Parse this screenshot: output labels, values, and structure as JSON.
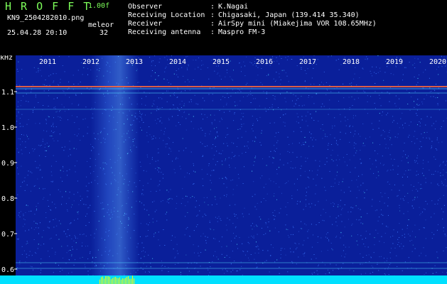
{
  "header": {
    "app_title": "H R O F F T",
    "version": "1.00f",
    "filename": "KN9_2504282010.png",
    "datetime": "25.04.28 20:10",
    "mode_label": "meleor",
    "mode_value": "32",
    "meta": [
      {
        "key": "Observer",
        "value": "K.Nagai"
      },
      {
        "key": "Receiving Location",
        "value": "Chigasaki, Japan (139.414 35.340)"
      },
      {
        "key": "Receiver",
        "value": "AirSpy mini (Miakejima VOR 108.65MHz)"
      },
      {
        "key": "Receiving antenna",
        "value": "Maspro FM-3"
      }
    ],
    "separator": ":"
  },
  "spectrogram": {
    "y_unit": "kHz",
    "y_ticks": [
      "1.1",
      "1.0",
      "0.9",
      "0.8",
      "0.7",
      "0.6"
    ],
    "x_ticks": [
      "2011",
      "2012",
      "2013",
      "2014",
      "2015",
      "2016",
      "2017",
      "2018",
      "2019",
      "2020"
    ],
    "colors": {
      "background": "#0a1f9a",
      "noise_light": "#3c78ff",
      "noise_cyan": "#50d8ff",
      "band_line": "#ff6a3a",
      "bottom_band": "#00e0ff",
      "bottom_spike": "#ffff00",
      "text": "#ffffff"
    }
  }
}
